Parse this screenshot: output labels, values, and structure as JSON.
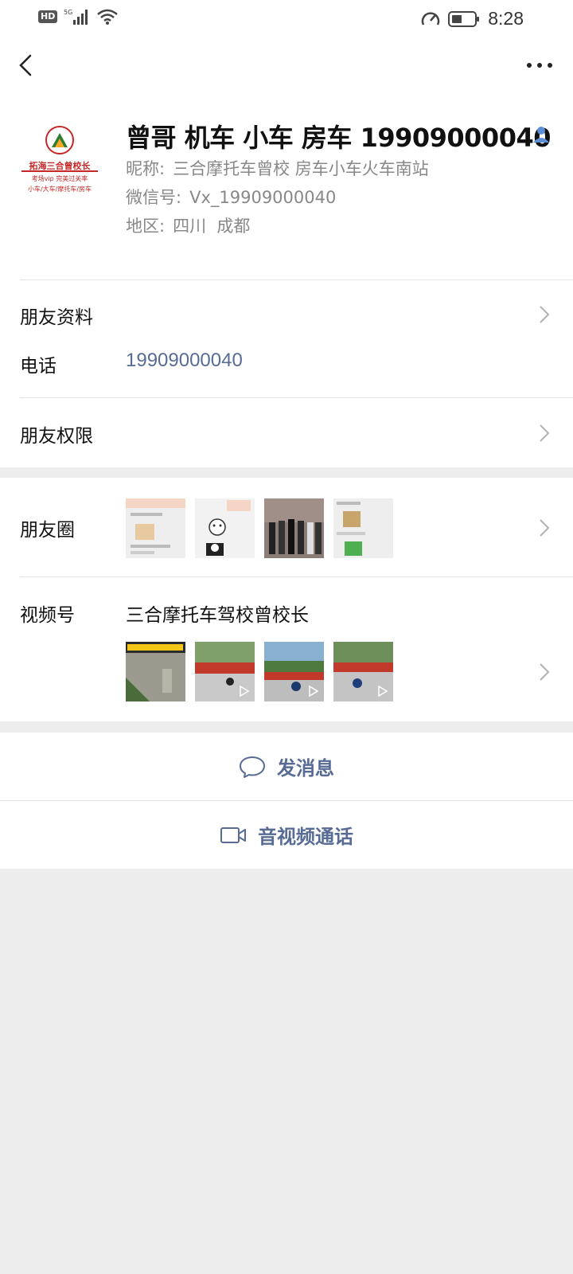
{
  "status_bar": {
    "time": "8:28",
    "hd_badge": "HD",
    "network": "5G",
    "icons": [
      "hd-icon",
      "signal-icon",
      "wifi-icon",
      "speed-icon",
      "battery-icon"
    ]
  },
  "top_bar": {
    "back_icon": "chevron-left-icon",
    "more_icon": "more-dots-icon"
  },
  "profile": {
    "name": "曾哥 机车 小车 房车 19909000040",
    "nickname_label": "昵称:",
    "nickname": "三合摩托车曾校 房车小车火车南站",
    "wechat_id_label": "微信号:",
    "wechat_id": "Vx_19909000040",
    "region_label": "地区:",
    "region": "四川  成都",
    "avatar": {
      "title": "拓海三合曾校长",
      "line1": "考场vip 完美过关率",
      "line2": "小车/大车/摩托车/房车"
    },
    "person_icon": "contact-person-icon"
  },
  "rows": {
    "friend_info": "朋友资料",
    "phone_label": "电话",
    "phone_value": "19909000040",
    "friend_permission": "朋友权限",
    "moments": "朋友圈",
    "channels": "视频号",
    "channel_name": "三合摩托车驾校曾校长"
  },
  "actions": {
    "message": "发消息",
    "message_icon": "chat-bubble-icon",
    "call": "音视频通话",
    "call_icon": "video-camera-icon"
  },
  "colors": {
    "link_blue": "#576b95",
    "background": "#ededed",
    "card": "#ffffff"
  }
}
